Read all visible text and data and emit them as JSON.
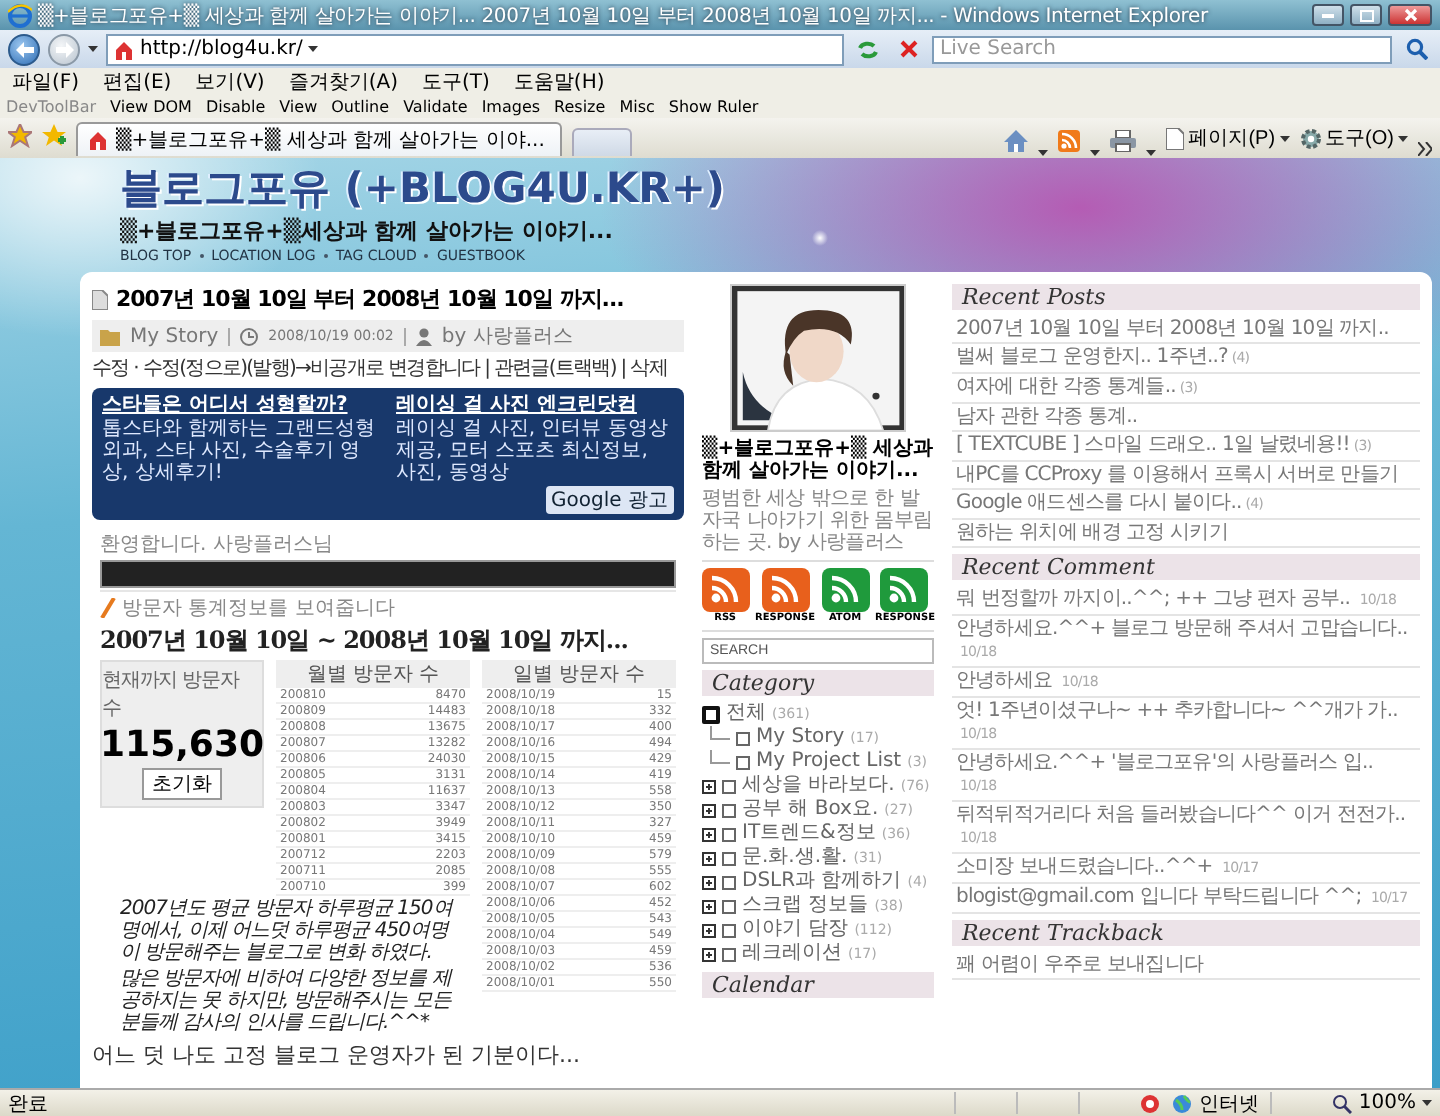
{
  "window": {
    "title": "▒+블로그포유+▒ 세상과 함께 살아가는 이야기... 2007년 10월 10일 부터 2008년 10월 10일 까지... - Windows Internet Explorer"
  },
  "address_bar": {
    "url": "http://blog4u.kr/"
  },
  "search": {
    "placeholder": "Live Search"
  },
  "menu": [
    "파일(F)",
    "편집(E)",
    "보기(V)",
    "즐겨찾기(A)",
    "도구(T)",
    "도움말(H)"
  ],
  "dev_toolbar": {
    "title": "DevToolBar",
    "items": [
      "View DOM",
      "Disable",
      "View",
      "Outline",
      "Validate",
      "Images",
      "Resize",
      "Misc",
      "Show Ruler"
    ]
  },
  "tabs": [
    {
      "label": "▒+블로그포유+▒ 세상과 함께 살아가는 이야...",
      "selected": true
    }
  ],
  "command_bar": [
    "페이지(P)",
    "도구(O)"
  ],
  "blog": {
    "title": "블로그포유 (+BLOG4U.KR+)",
    "subtitle": "▒+블로그포유+▒세상과 함께 살아가는 이야기...",
    "nav": [
      "BLOG TOP",
      "LOCATION LOG",
      "TAG CLOUD",
      "GUESTBOOK"
    ]
  },
  "post": {
    "title": "2007년 10월 10일 부터 2008년 10월 10일 까지...",
    "category": "My Story",
    "date": "2008/10/19 00:02",
    "author": "by 사랑플러스",
    "admin_links": "수정 · 수정(정으로)(발행)→비공개로 변경합니다 | 관련글(트랙백) | 삭제",
    "ads": [
      {
        "title": "스타들은 어디서 성형할까?",
        "text": "톱스타와 함께하는 그랜드성형외과, 스타 사진, 수술후기 영상, 상세후기!"
      },
      {
        "title": "레이싱 걸 사진 엔크린닷컴",
        "text": "레이싱 걸 사진, 인터뷰 동영상 제공, 모터 스포츠 최신정보, 사진, 동영상"
      }
    ],
    "ad_label": "Google 광고",
    "screenshot": {
      "greeting": "환영합니다. 사랑플러스님",
      "info": "방문자 통계정보를 보여줍니다",
      "heading": "2007년 10월 10일 ~ 2008년 10월 10일 까지...",
      "total_label": "현재까지 방문자 수",
      "total": "115,630",
      "reset_button": "초기화",
      "monthly": {
        "heading": "월별 방문자 수",
        "rows": [
          [
            "200810",
            "8470"
          ],
          [
            "200809",
            "14483"
          ],
          [
            "200808",
            "13675"
          ],
          [
            "200807",
            "13282"
          ],
          [
            "200806",
            "24030"
          ],
          [
            "200805",
            "3131"
          ],
          [
            "200804",
            "11637"
          ],
          [
            "200803",
            "3347"
          ],
          [
            "200802",
            "3949"
          ],
          [
            "200801",
            "3415"
          ],
          [
            "200712",
            "2203"
          ],
          [
            "200711",
            "2085"
          ],
          [
            "200710",
            "399"
          ]
        ]
      },
      "daily": {
        "heading": "일별 방문자 수",
        "rows": [
          [
            "2008/10/19",
            "15"
          ],
          [
            "2008/10/18",
            "332"
          ],
          [
            "2008/10/17",
            "400"
          ],
          [
            "2008/10/16",
            "494"
          ],
          [
            "2008/10/15",
            "429"
          ],
          [
            "2008/10/14",
            "419"
          ],
          [
            "2008/10/13",
            "558"
          ],
          [
            "2008/10/12",
            "350"
          ],
          [
            "2008/10/11",
            "327"
          ],
          [
            "2008/10/10",
            "459"
          ],
          [
            "2008/10/09",
            "579"
          ],
          [
            "2008/10/08",
            "555"
          ],
          [
            "2008/10/07",
            "602"
          ],
          [
            "2008/10/06",
            "452"
          ],
          [
            "2008/10/05",
            "543"
          ],
          [
            "2008/10/04",
            "549"
          ],
          [
            "2008/10/03",
            "459"
          ],
          [
            "2008/10/02",
            "536"
          ],
          [
            "2008/10/01",
            "550"
          ]
        ]
      },
      "notes": [
        "2007년도 평균 방문자 하루평균 150여명에서, 이제 어느덧 하루평균 450여명이 방문해주는 블로그로 변화 하였다.",
        "많은 방문자에 비하여 다양한 정보를 제공하지는 못 하지만, 방문해주시는 모든 분들께 감사의 인사를 드립니다.^^*"
      ]
    },
    "closing": "어느 덧 나도 고정 블로그 운영자가 된 기분이다..."
  },
  "profile": {
    "name": "▒+블로그포유+▒ 세상과 함께 살아가는 이야기...",
    "description": "평범한 세상 밖으로 한 발자국 나아가기 위한 몸부림 하는 곳. by 사랑플러스"
  },
  "feeds": [
    {
      "label": "RSS",
      "color": "#e8601c"
    },
    {
      "label": "RESPONSE",
      "color": "#e8601c"
    },
    {
      "label": "ATOM",
      "color": "#1f9a3c"
    },
    {
      "label": "RESPONSE",
      "color": "#1f9a3c"
    }
  ],
  "sidebar_search": {
    "placeholder": "SEARCH"
  },
  "category": {
    "heading": "Category",
    "root": {
      "label": "전체",
      "count": "(361)",
      "children": [
        {
          "label": "My Story",
          "count": "(17)",
          "expandable": false
        },
        {
          "label": "My Project List",
          "count": "(3)",
          "expandable": false
        },
        {
          "label": "세상을 바라보다.",
          "count": "(76)",
          "expandable": true
        },
        {
          "label": "공부 해 Box요.",
          "count": "(27)",
          "expandable": true
        },
        {
          "label": "IT트렌드&정보",
          "count": "(36)",
          "expandable": true
        },
        {
          "label": "문.화.생.활.",
          "count": "(31)",
          "expandable": true
        },
        {
          "label": "DSLR과 함께하기",
          "count": "(4)",
          "expandable": true
        },
        {
          "label": "스크랩 정보들",
          "count": "(38)",
          "expandable": true
        },
        {
          "label": "이야기 담장",
          "count": "(112)",
          "expandable": true
        },
        {
          "label": "레크레이션",
          "count": "(17)",
          "expandable": true
        }
      ]
    }
  },
  "calendar": {
    "heading": "Calendar"
  },
  "recent_posts": {
    "heading": "Recent Posts",
    "items": [
      {
        "title": "2007년 10월 10일 부터 2008년 10월 10일 까지.."
      },
      {
        "title": "벌써 블로그 운영한지.. 1주년..?",
        "count": "(4)"
      },
      {
        "title": "여자에 대한 각종 통계들..",
        "count": "(3)"
      },
      {
        "title": "남자 관한 각종 통계.."
      },
      {
        "title": "[ TEXTCUBE ] 스마일 드래오.. 1일 날렸네용!!",
        "count": "(3)"
      },
      {
        "title": "내PC를 CCProxy 를 이용해서 프록시 서버로 만들기"
      },
      {
        "title": "Google 애드센스를 다시 붙이다..",
        "count": "(4)"
      },
      {
        "title": "원하는 위치에 배경 고정 시키기"
      }
    ]
  },
  "recent_comments": {
    "heading": "Recent Comment",
    "items": [
      {
        "text": "뭐 번정할까 까지이..^^; ++ 그냥 편자 공부..",
        "date": "10/18"
      },
      {
        "text": "안녕하세요.^^+ 블로그 방문해 주셔서 고맙습니다..",
        "date": "10/18"
      },
      {
        "text": "안녕하세요",
        "date": "10/18"
      },
      {
        "text": "엇! 1주년이셨구나~ ++ 추카합니다~ ^^개가 가..",
        "date": "10/18"
      },
      {
        "text": "안녕하세요.^^+ '블로그포유'의 사랑플러스 입..",
        "date": "10/18"
      },
      {
        "text": "뒤적뒤적거리다 처음 들러봤습니다^^ 이거 전전가..",
        "date": "10/18"
      },
      {
        "text": "소미장 보내드렸습니다..^^+",
        "date": "10/17"
      },
      {
        "text": "blogist@gmail.com 입니다 부탁드립니다 ^^;",
        "date": "10/17"
      }
    ]
  },
  "recent_trackback": {
    "heading": "Recent Trackback",
    "items": [
      {
        "text": "꽤 어렴이 우주로 보내집니다"
      }
    ]
  },
  "status_bar": {
    "text": "완료",
    "zone": "인터넷",
    "zoom": "100%"
  }
}
